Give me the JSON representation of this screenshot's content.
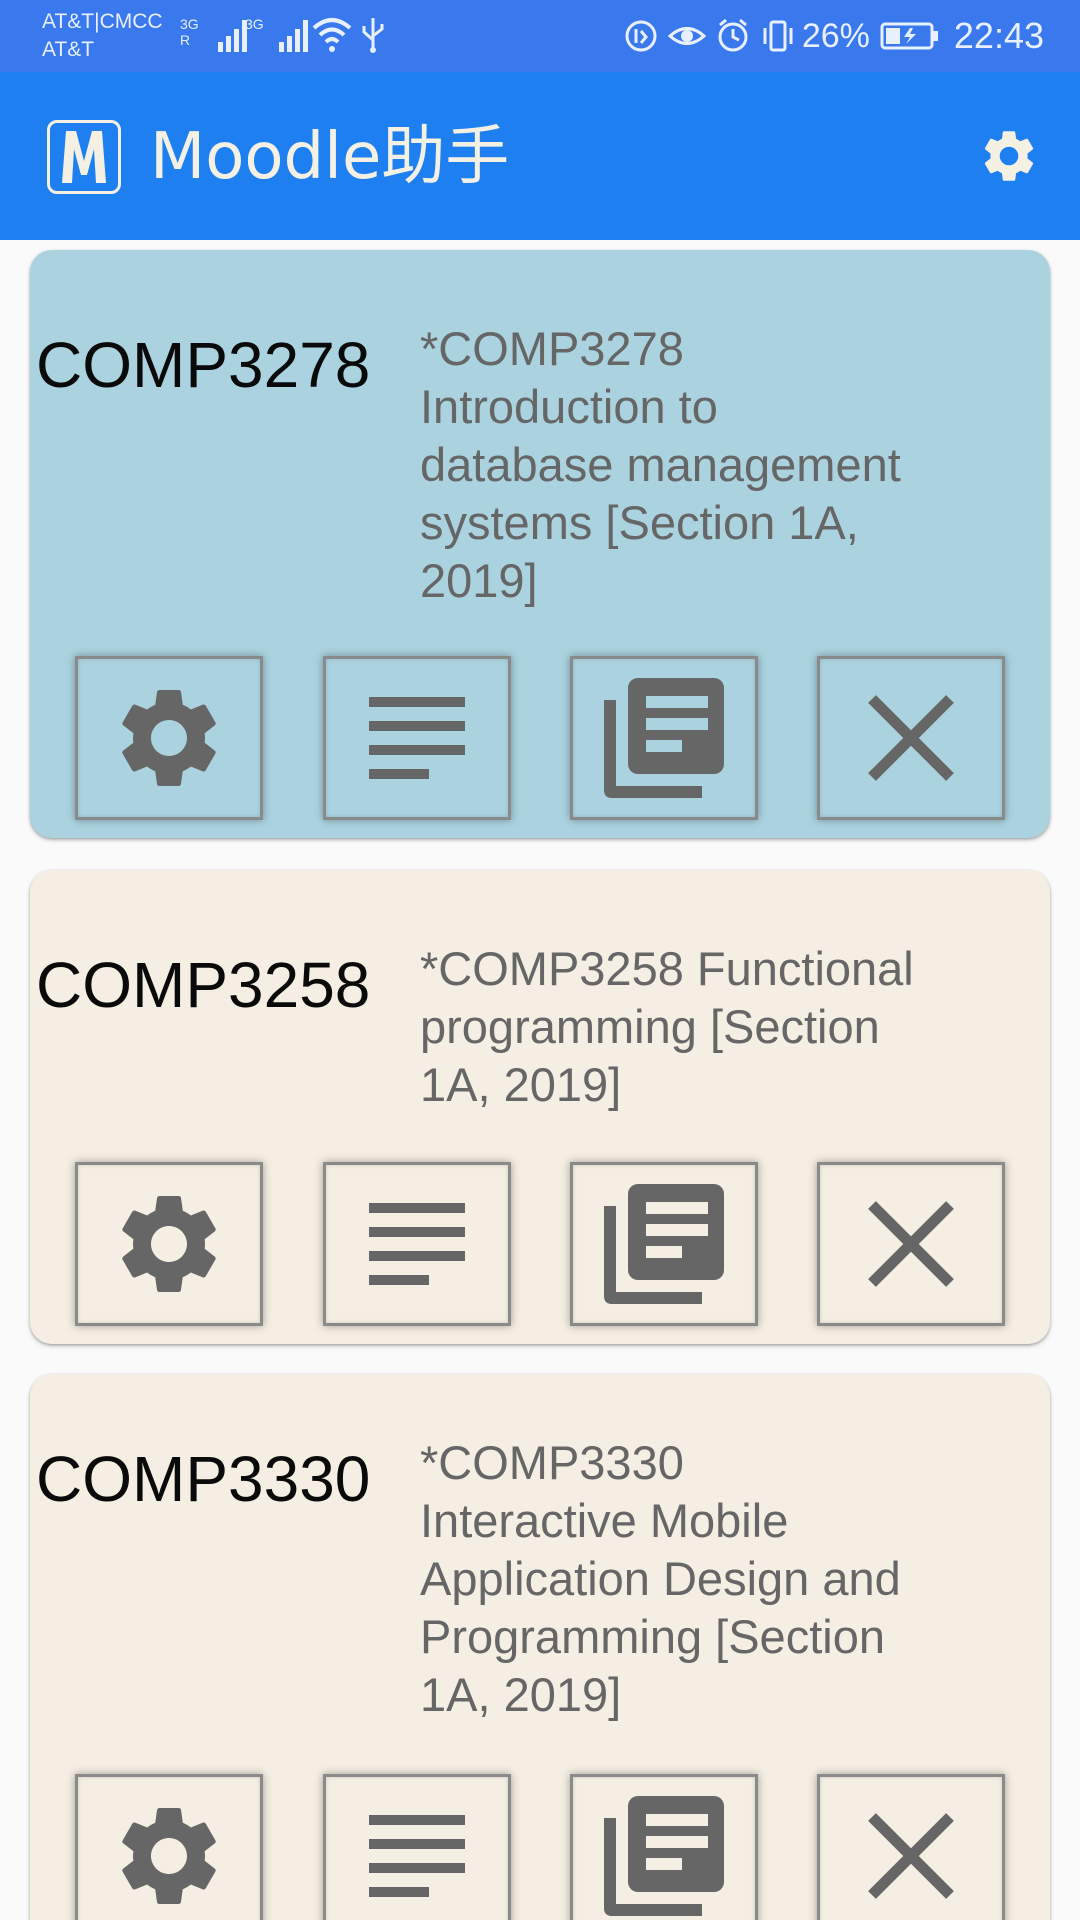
{
  "status_bar": {
    "carrier_line1": "AT&T|CMCC",
    "carrier_line2": "AT&T",
    "signal1_label": "3G R",
    "signal2_label": "3G",
    "battery_percent": "26%",
    "time": "22:43",
    "icons": [
      "signal-icon",
      "signal-icon",
      "wifi-icon",
      "usb-icon",
      "data-saver-icon",
      "eye-comfort-icon",
      "alarm-icon",
      "vibrate-icon",
      "battery-charging-icon"
    ]
  },
  "app_bar": {
    "title": "Moodle助手",
    "logo_letter": "M",
    "settings_icon": "gear-icon"
  },
  "courses": [
    {
      "code": "COMP3278",
      "name": "*COMP3278 Introduction to database management systems [Section 1A, 2019]",
      "name_lines": [
        "*COMP3278",
        "Introduction to",
        "database management",
        "systems [Section 1A,",
        "2019]"
      ],
      "selected": true
    },
    {
      "code": "COMP3258",
      "name": "*COMP3258 Functional programming [Section 1A, 2019]",
      "name_lines": [
        "*COMP3258 Functional",
        "programming [Section",
        "1A, 2019]"
      ],
      "selected": false
    },
    {
      "code": "COMP3330",
      "name": "*COMP3330 Interactive Mobile Application Design and Programming [Section 1A, 2019]",
      "name_lines": [
        "*COMP3330",
        "Interactive Mobile",
        "Application Design and",
        "Programming [Section",
        "1A, 2019]"
      ],
      "selected": false
    }
  ],
  "card_actions": [
    "gear-icon",
    "notes-icon",
    "library-icon",
    "close-icon"
  ],
  "colors": {
    "status_bar": "#3a78ee",
    "app_bar": "#1e80f0",
    "card_selected": "#abd3df",
    "card_normal": "#f5eee2",
    "icon_gray": "#666666"
  }
}
